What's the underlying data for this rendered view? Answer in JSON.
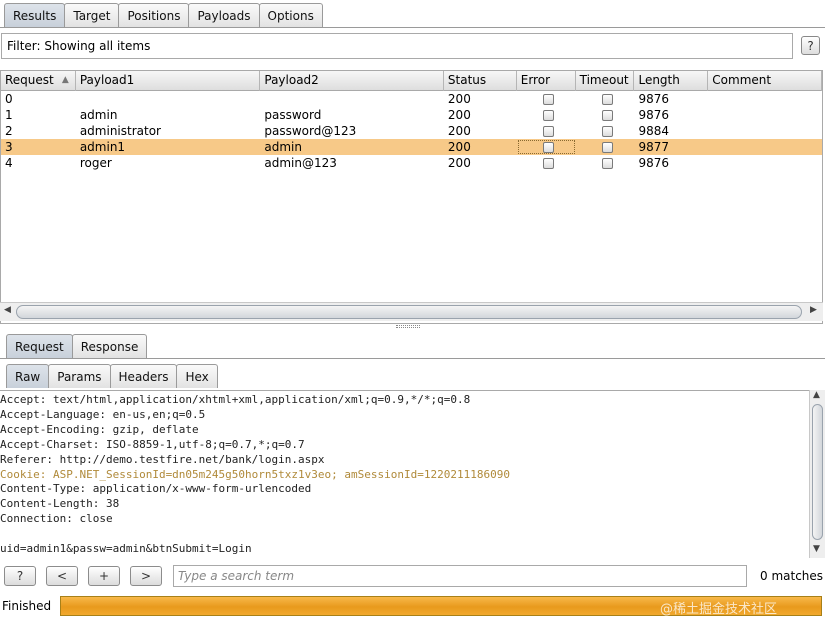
{
  "top_tabs": [
    "Results",
    "Target",
    "Positions",
    "Payloads",
    "Options"
  ],
  "filter": {
    "text": "Filter: Showing all items",
    "help": "?"
  },
  "table": {
    "columns": [
      "Request",
      "Payload1",
      "Payload2",
      "Status",
      "Error",
      "Timeout",
      "Length",
      "Comment"
    ],
    "sort_indicator": "▲",
    "rows": [
      {
        "request": "0",
        "payload1": "",
        "payload2": "",
        "status": "200",
        "error": false,
        "timeout": false,
        "length": "9876",
        "comment": ""
      },
      {
        "request": "1",
        "payload1": "admin",
        "payload2": "password",
        "status": "200",
        "error": false,
        "timeout": false,
        "length": "9876",
        "comment": ""
      },
      {
        "request": "2",
        "payload1": "administrator",
        "payload2": "password@123",
        "status": "200",
        "error": false,
        "timeout": false,
        "length": "9884",
        "comment": ""
      },
      {
        "request": "3",
        "payload1": "admin1",
        "payload2": "admin",
        "status": "200",
        "error": false,
        "timeout": false,
        "length": "9877",
        "comment": ""
      },
      {
        "request": "4",
        "payload1": "roger",
        "payload2": "admin@123",
        "status": "200",
        "error": false,
        "timeout": false,
        "length": "9876",
        "comment": ""
      }
    ],
    "selected_row": 3
  },
  "rr_tabs": [
    "Request",
    "Response"
  ],
  "sub_tabs": [
    "Raw",
    "Params",
    "Headers",
    "Hex"
  ],
  "raw_lines": [
    "Accept: text/html,application/xhtml+xml,application/xml;q=0.9,*/*;q=0.8",
    "Accept-Language: en-us,en;q=0.5",
    "Accept-Encoding: gzip, deflate",
    "Accept-Charset: ISO-8859-1,utf-8;q=0.7,*;q=0.7",
    "Referer: http://demo.testfire.net/bank/login.aspx",
    "Cookie: ASP.NET_SessionId=dn05m245g50horn5txz1v3eo; amSessionId=1220211186090",
    "Content-Type: application/x-www-form-urlencoded",
    "Content-Length: 38",
    "Connection: close",
    "",
    "uid=admin1&passw=admin&btnSubmit=Login"
  ],
  "search": {
    "buttons": [
      "?",
      "<",
      "+",
      ">"
    ],
    "placeholder": "Type a search term",
    "matches": "0 matches"
  },
  "status": {
    "text": "Finished",
    "progress": 1.0,
    "watermark": "@稀土掘金技术社区"
  },
  "colors": {
    "selected_row": "#f7c988",
    "progress": "#e89a1d"
  }
}
